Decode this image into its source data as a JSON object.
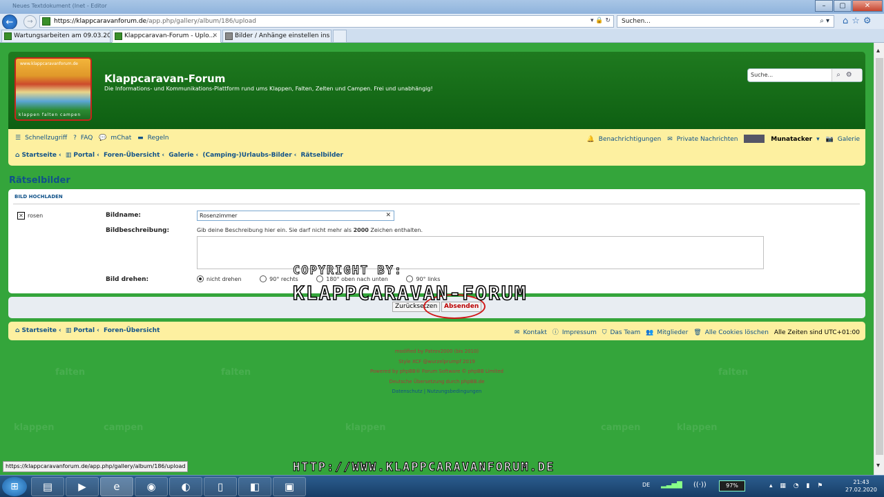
{
  "window": {
    "title_fragment": "Neues Textdokument (Inet - Editor",
    "btn_min": "–",
    "btn_max": "▢",
    "btn_close": "✕"
  },
  "browser": {
    "url_host": "https://klappcaravanforum.de",
    "url_path": "/app.php/gallery/album/186/upload",
    "search_placeholder": "Suchen...",
    "tabs": [
      {
        "label": "Wartungsarbeiten am 09.03.20..."
      },
      {
        "label": "Klappcaravan-Forum - Uplo...",
        "close": "✕"
      },
      {
        "label": "Bilder / Anhänge einstellen ins ..."
      }
    ]
  },
  "site": {
    "logo_url_text": "www.klappcaravanforum.de",
    "logo_words": "klappen  falten  campen",
    "title": "Klappcaravan-Forum",
    "description": "Die Informations- und Kommunikations-Plattform rund ums Klappen, Falten, Zelten und Campen. Frei und unabhängig!",
    "search_placeholder": "Suche..."
  },
  "navbar": {
    "left": [
      "Schnellzugriff",
      "FAQ",
      "mChat",
      "Regeln"
    ],
    "right": [
      "Benachrichtigungen",
      "Private Nachrichten"
    ],
    "user": "Munatacker",
    "gallery": "Galerie",
    "breadcrumbs": [
      "Startseite",
      "Portal",
      "Foren-Übersicht",
      "Galerie",
      "(Camping-)Urlaubs-Bilder",
      "Rätselbilder"
    ]
  },
  "page": {
    "title": "Rätselbilder",
    "panel_header": "BILD HOCHLADEN",
    "thumb_name": "rosen",
    "label_name": "Bildname:",
    "name_value": "Rosenzimmer",
    "label_desc": "Bildbeschreibung:",
    "desc_hint_a": "Gib deine Beschreibung hier ein. Sie darf nicht mehr als ",
    "desc_hint_b": "2000",
    "desc_hint_c": " Zeichen enthalten.",
    "label_rotate": "Bild drehen:",
    "rotate_options": [
      "nicht drehen",
      "90° rechts",
      "180° oben nach unten",
      "90° links"
    ],
    "btn_reset": "Zurücksetzen",
    "btn_submit": "Absenden"
  },
  "footer": {
    "crumbs": [
      "Startseite",
      "Portal",
      "Foren-Übersicht"
    ],
    "links": [
      "Kontakt",
      "Impressum",
      "Das Team",
      "Mitglieder",
      "Alle Cookies löschen"
    ],
    "timezone": "Alle Zeiten sind UTC+01:00",
    "credits": [
      "modified by Patrov2000 (bis 2010)",
      "Style XCF @wurzelprumpf 2019",
      "Powered by phpBB® Forum Software © phpBB Limited",
      "Deutsche Übersetzung durch phpBB.de",
      "Datenschutz | Nutzungsbedingungen"
    ]
  },
  "watermark": {
    "line1": "COPYRIGHT BY:",
    "line2": "KLAPPCARAVAN-FORUM",
    "bottom": "HTTP://WWW.KLAPPCARAVANFORUM.DE"
  },
  "status_url": "https://klappcaravanforum.de/app.php/gallery/album/186/upload",
  "taskbar": {
    "lang": "DE",
    "battery": "97%",
    "time": "21:43",
    "date": "27.02.2020"
  }
}
